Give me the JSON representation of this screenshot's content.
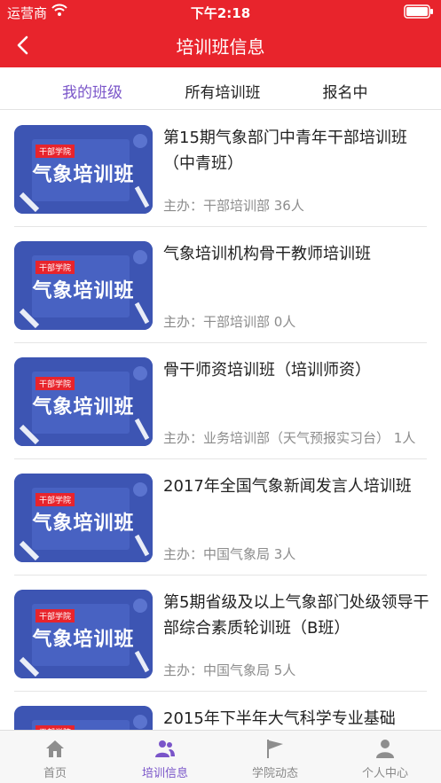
{
  "status_bar": {
    "carrier": "运营商",
    "time": "下午2:18"
  },
  "nav": {
    "title": "培训班信息"
  },
  "tabs": [
    {
      "label": "我的班级",
      "active": true
    },
    {
      "label": "所有培训班",
      "active": false
    },
    {
      "label": "报名中",
      "active": false
    }
  ],
  "thumbnail": {
    "badge": "干部学院",
    "title": "气象培训班"
  },
  "courses": [
    {
      "name": "第15期气象部门中青年干部培训班（中青班）",
      "meta": "主办：干部培训部  36人"
    },
    {
      "name": "气象培训机构骨干教师培训班",
      "meta": "主办：干部培训部  0人"
    },
    {
      "name": "骨干师资培训班（培训师资）",
      "meta": "主办：业务培训部（天气预报实习台）  1人"
    },
    {
      "name": "2017年全国气象新闻发言人培训班",
      "meta": "主办：中国气象局  3人"
    },
    {
      "name": "第5期省级及以上气象部门处级领导干部综合素质轮训班（B班）",
      "meta": "主办：中国气象局  5人"
    },
    {
      "name": "2015年下半年大气科学专业基础",
      "meta": ""
    }
  ],
  "bottom_tabs": [
    {
      "label": "首页",
      "icon": "home-icon",
      "active": false
    },
    {
      "label": "培训信息",
      "icon": "people-icon",
      "active": true
    },
    {
      "label": "学院动态",
      "icon": "flag-icon",
      "active": false
    },
    {
      "label": "个人中心",
      "icon": "person-icon",
      "active": false
    }
  ],
  "colors": {
    "primary_red": "#e8242c",
    "active_purple": "#7a55c9",
    "thumb_blue": "#3d55b3"
  }
}
